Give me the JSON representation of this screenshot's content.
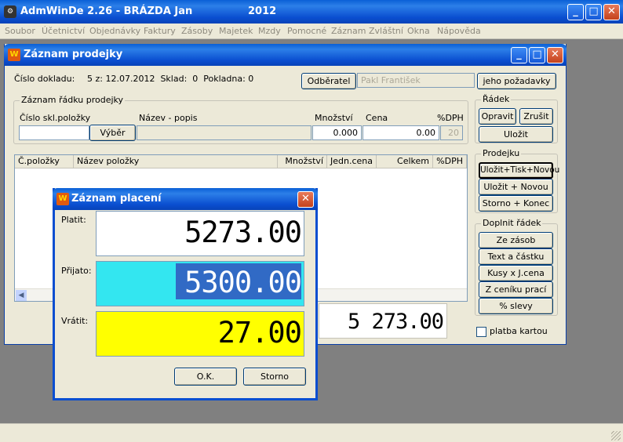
{
  "app": {
    "title": "AdmWinDe 2.26 - BRÁZDA Jan",
    "year": "2012"
  },
  "menu": [
    "Soubor",
    "Účetnictví",
    "Objednávky",
    "Faktury",
    "Zásoby",
    "Majetek",
    "Mzdy",
    "Pomocné",
    "Záznam",
    "Zvláštní",
    "Okna",
    "Nápověda"
  ],
  "record_window": {
    "title": "Záznam prodejky",
    "doc_label": "Číslo dokladu:",
    "doc_value": "5 z: 12.07.2012  Sklad:  0  Pokladna: 0",
    "customer_button": "Odběratel",
    "customer_value": "Pakl František",
    "requests_button": "jeho požadavky",
    "line_group": {
      "title": "Záznam řádku prodejky",
      "col_item": "Číslo skl.položky",
      "col_name": "Název - popis",
      "col_qty": "Množství",
      "col_price": "Cena",
      "col_vat": "%DPH",
      "select_button": "Výběr",
      "qty_value": "0.000",
      "price_value": "0.00",
      "vat_value": "20"
    },
    "grid_headers": [
      "Č.položky",
      "Název položky",
      "Množství",
      "Jedn.cena",
      "Celkem",
      "%DPH"
    ],
    "total": "5 273.00",
    "row_group": {
      "title": "Řádek",
      "edit": "Opravit",
      "cancel": "Zrušit",
      "save": "Uložit"
    },
    "receipt_group": {
      "title": "Prodejku",
      "save_print_new": "Uložit+Tisk+Novou",
      "save_new": "Uložit + Novou",
      "cancel_end": "Storno + Konec"
    },
    "fill_group": {
      "title": "Doplnit řádek",
      "from_stock": "Ze zásob",
      "text_amount": "Text a částku",
      "pieces_price": "Kusy x J.cena",
      "price_list": "Z ceníku prací",
      "discount": "% slevy"
    },
    "card_payment": "platba kartou"
  },
  "payment_dialog": {
    "title": "Záznam placení",
    "pay_label": "Platit:",
    "pay_value": "5273.00",
    "received_label": "Přijato:",
    "received_value": "5300.00",
    "return_label": "Vrátit:",
    "return_value": "27.00",
    "ok_button": "O.K.",
    "cancel_button": "Storno"
  },
  "colors": {
    "received_bg": "#33e6f0",
    "received_sel": "#316ac5",
    "return_bg": "#ffff00"
  }
}
